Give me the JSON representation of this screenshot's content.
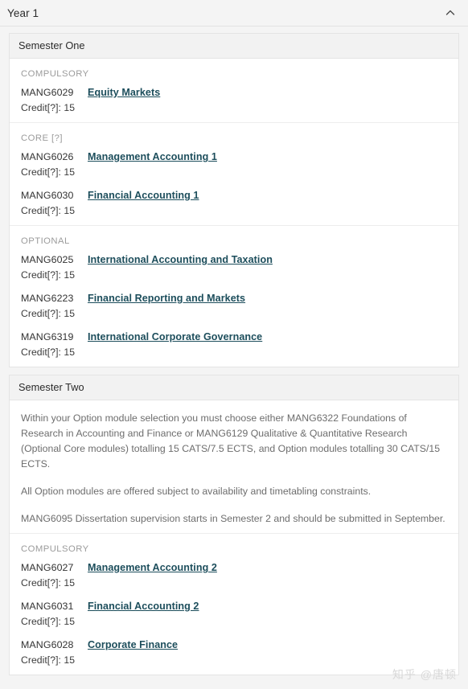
{
  "year": {
    "title": "Year 1",
    "collapse_icon": "chevron-up-icon"
  },
  "watermark": "知乎 @唐顿",
  "semesters": [
    {
      "title": "Semester One",
      "notes": [],
      "groups": [
        {
          "label": "COMPULSORY",
          "modules": [
            {
              "code": "MANG6029",
              "name": "Equity Markets",
              "credit": "Credit[?]: 15"
            }
          ]
        },
        {
          "label": "CORE [?]",
          "modules": [
            {
              "code": "MANG6026",
              "name": "Management Accounting 1",
              "credit": "Credit[?]: 15"
            },
            {
              "code": "MANG6030",
              "name": "Financial Accounting 1",
              "credit": "Credit[?]: 15"
            }
          ]
        },
        {
          "label": "OPTIONAL",
          "modules": [
            {
              "code": "MANG6025",
              "name": "International Accounting and Taxation",
              "credit": "Credit[?]: 15"
            },
            {
              "code": "MANG6223",
              "name": "Financial Reporting and Markets",
              "credit": "Credit[?]: 15"
            },
            {
              "code": "MANG6319",
              "name": "International Corporate Governance",
              "credit": "Credit[?]: 15"
            }
          ]
        }
      ]
    },
    {
      "title": "Semester Two",
      "notes": [
        "Within your Option module selection you must choose either MANG6322 Foundations of Research in Accounting and Finance or MANG6129 Qualitative & Quantitative Research (Optional Core modules) totalling 15 CATS/7.5 ECTS, and Option modules totalling 30 CATS/15 ECTS.",
        "All Option modules are offered subject to availability and timetabling constraints.",
        "MANG6095 Dissertation supervision starts in Semester 2 and should be submitted in September."
      ],
      "groups": [
        {
          "label": "COMPULSORY",
          "modules": [
            {
              "code": "MANG6027",
              "name": "Management Accounting 2",
              "credit": "Credit[?]: 15"
            },
            {
              "code": "MANG6031",
              "name": "Financial Accounting 2",
              "credit": "Credit[?]: 15"
            },
            {
              "code": "MANG6028",
              "name": "Corporate Finance",
              "credit": "Credit[?]: 15"
            }
          ]
        }
      ]
    }
  ]
}
